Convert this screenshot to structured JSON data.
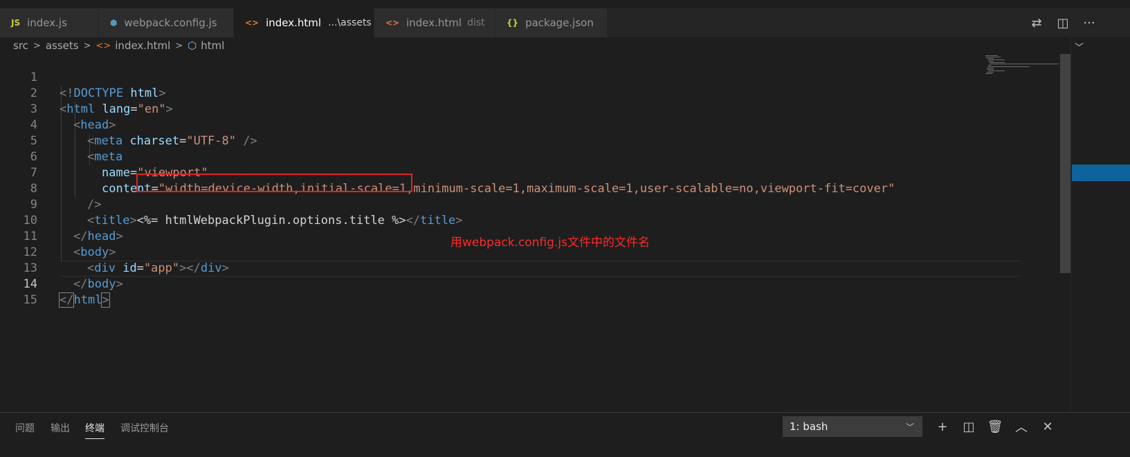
{
  "tabs": [
    {
      "icon": "JS",
      "label": "index.js",
      "hint": ""
    },
    {
      "icon": "⬢",
      "label": "webpack.config.js",
      "hint": ""
    },
    {
      "icon": "<>",
      "label": "index.html",
      "hint": "...\\assets",
      "close": "✕"
    },
    {
      "icon": "<>",
      "label": "index.html",
      "hint": "dist"
    },
    {
      "icon": "{}",
      "label": "package.json",
      "hint": ""
    }
  ],
  "tab_actions": {
    "compare": "⇄",
    "split": "◫",
    "more": "···"
  },
  "breadcrumb": {
    "seg1": "src",
    "seg2": "assets",
    "seg3": "index.html",
    "seg4": "html",
    "separator": ">"
  },
  "line_numbers": [
    "1",
    "2",
    "3",
    "4",
    "5",
    "6",
    "7",
    "8",
    "9",
    "10",
    "11",
    "12",
    "13",
    "14",
    "15"
  ],
  "code": {
    "l1": {
      "open": "<!",
      "doctype": "DOCTYPE",
      "sp": " ",
      "kw": "html",
      "close": ">"
    },
    "l2": {
      "open": "<",
      "tag": "html",
      "attr": " lang",
      "eq": "=",
      "val": "\"en\"",
      "close": ">"
    },
    "l3": {
      "open": "<",
      "tag": "head",
      "close": ">"
    },
    "l4": {
      "open": "<",
      "tag": "meta",
      "attr": " charset",
      "eq": "=",
      "val": "\"UTF-8\"",
      "close": " />"
    },
    "l5": {
      "open": "<",
      "tag": "meta"
    },
    "l6": {
      "attr": "name",
      "eq": "=",
      "val": "\"viewport\""
    },
    "l7": {
      "attr": "content",
      "eq": "=",
      "val": "\"width=device-width,initial-scale=1,minimum-scale=1,maximum-scale=1,user-scalable=no,viewport-fit=cover\""
    },
    "l8": {
      "close": "/>"
    },
    "l9": {
      "open": "<",
      "tag": "title",
      "close": ">",
      "expr": "<%= htmlWebpackPlugin.options.title %>",
      "end_open": "</",
      "end_tag": "title",
      "end_close": ">"
    },
    "l10": {
      "open": "</",
      "tag": "head",
      "close": ">"
    },
    "l11": {
      "open": "<",
      "tag": "body",
      "close": ">"
    },
    "l12": {
      "open": "<",
      "tag": "div",
      "attr": " id",
      "eq": "=",
      "val": "\"app\"",
      "close": ">",
      "end_open": "</",
      "end_tag": "div",
      "end_close": ">"
    },
    "l13": {
      "open": "</",
      "tag": "body",
      "close": ">"
    },
    "l14": {
      "open": "</",
      "tag": "html",
      "close": ">"
    }
  },
  "annotation": "用webpack.config.js文件中的文件名",
  "panel": {
    "tabs": [
      "问题",
      "输出",
      "终端",
      "调试控制台"
    ],
    "active_tab": "终端",
    "terminal_selected": "1: bash",
    "actions": {
      "add": "+",
      "split": "◫",
      "trash": "🗑",
      "maximize": "︿",
      "close": "✕"
    }
  },
  "colors": {
    "tag": "#569cd6",
    "attr": "#9cdcfe",
    "string": "#ce9178",
    "punct": "#808080",
    "annotation": "#ff2a2a",
    "box": "#e02424"
  }
}
